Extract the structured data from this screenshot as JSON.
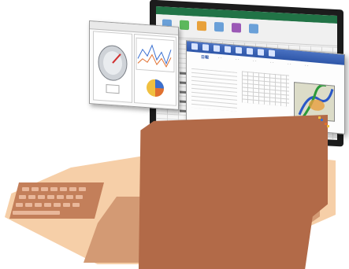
{
  "scene": {
    "panel_tabs": [
      "日報",
      "",
      "",
      "",
      "",
      "",
      "",
      ""
    ],
    "colors": {
      "lid": "#b26a48",
      "base": "#f6cfa8",
      "keyboard": "#c37f5a",
      "ribbon": "#217346",
      "blue_bar": "#2e56a8"
    }
  }
}
